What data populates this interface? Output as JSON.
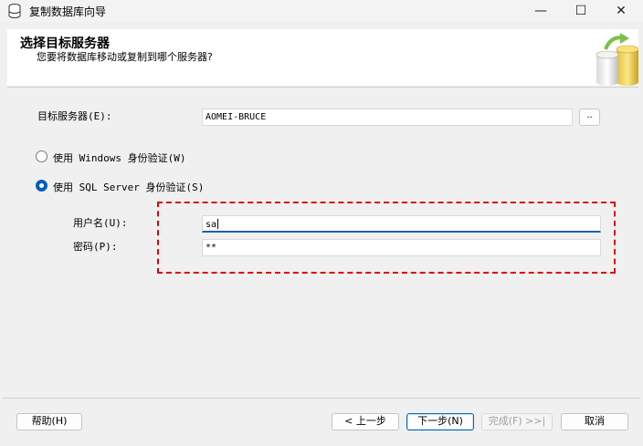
{
  "window": {
    "title": "复制数据库向导",
    "minimize_glyph": "—",
    "maximize_glyph": "☐",
    "close_glyph": "✕"
  },
  "header": {
    "title": "选择目标服务器",
    "subtitle": "您要将数据库移动或复制到哪个服务器?"
  },
  "form": {
    "server_label": "目标服务器(E):",
    "server_value": "AOMEI-BRUCE",
    "browse_label": "..",
    "auth_windows_label": "使用 Windows 身份验证(W)",
    "auth_sql_label": "使用 SQL Server 身份验证(S)",
    "auth_selected": "sql",
    "username_label": "用户名(U):",
    "username_value": "sa",
    "password_label": "密码(P):",
    "password_value": "**"
  },
  "buttons": {
    "help": "帮助(H)",
    "back": "< 上一步",
    "next": "下一步(N)",
    "finish": "完成(F) >>|",
    "cancel": "取消"
  },
  "colors": {
    "highlight_border": "#e00000",
    "accent": "#005fb8"
  },
  "icons": [
    "database-icon",
    "minimize-icon",
    "maximize-icon",
    "close-icon",
    "database-copy-graphic"
  ]
}
